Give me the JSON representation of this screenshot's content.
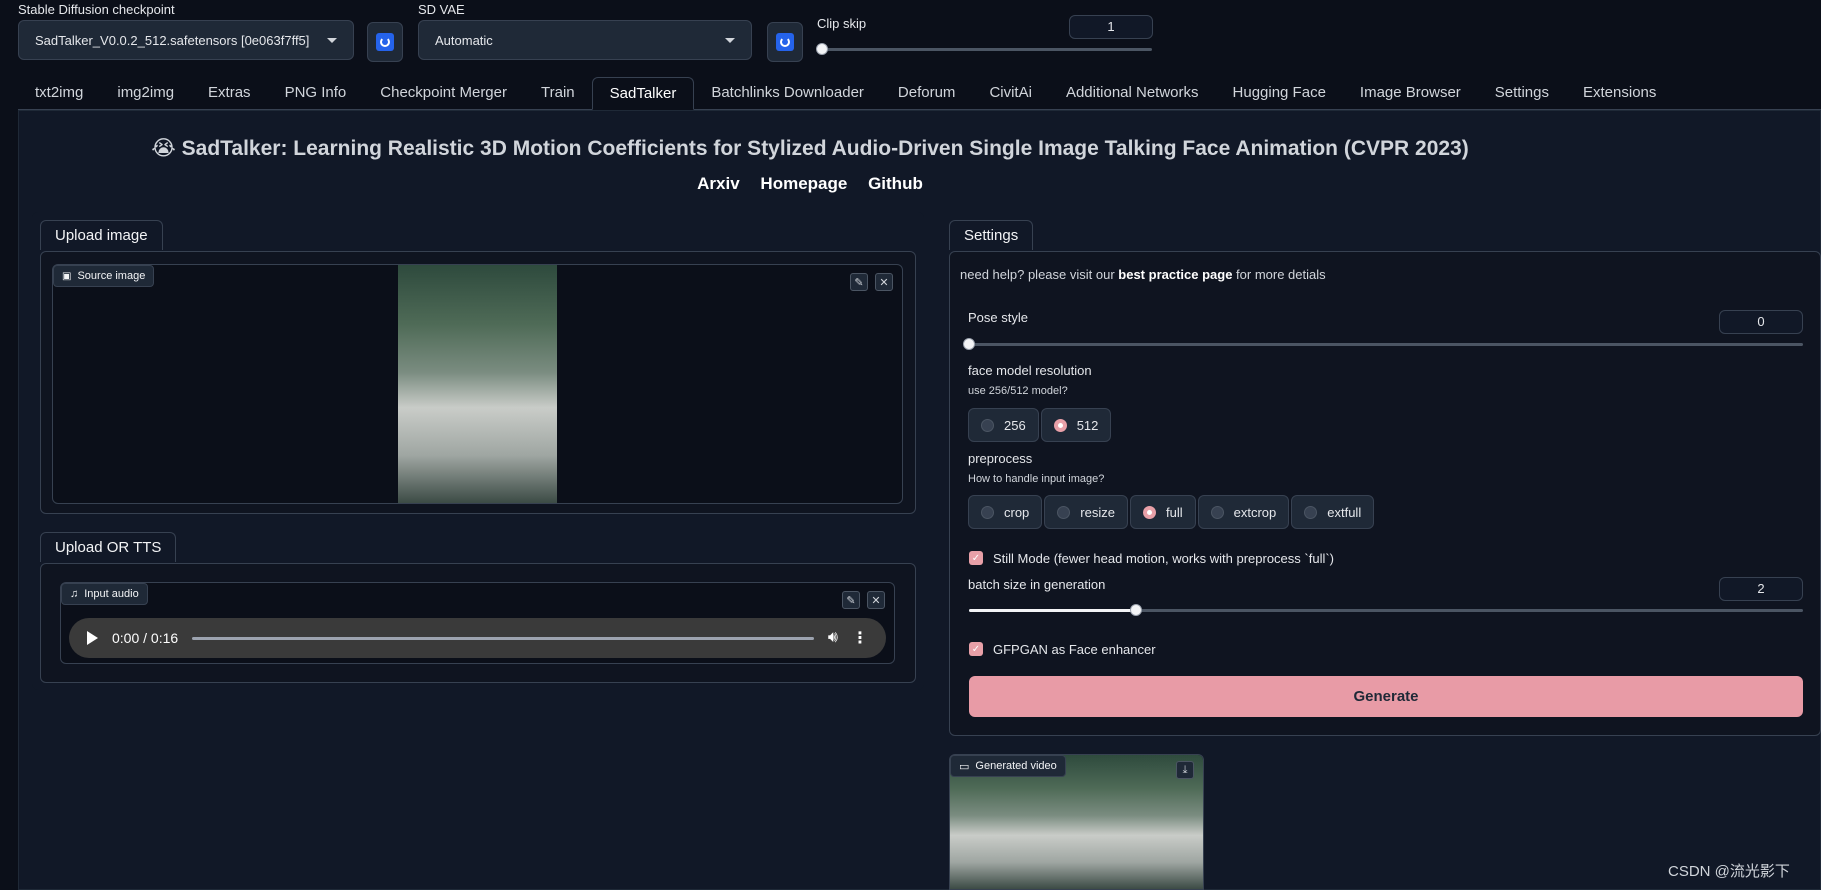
{
  "top": {
    "checkpoint_label": "Stable Diffusion checkpoint",
    "checkpoint_value": "SadTalker_V0.0.2_512.safetensors [0e063f7ff5]",
    "vae_label": "SD VAE",
    "vae_value": "Automatic",
    "clip_skip_label": "Clip skip",
    "clip_skip_value": "1",
    "clip_skip_level": 0
  },
  "tabs": [
    "txt2img",
    "img2img",
    "Extras",
    "PNG Info",
    "Checkpoint Merger",
    "Train",
    "SadTalker",
    "Batchlinks Downloader",
    "Deforum",
    "CivitAi",
    "Additional Networks",
    "Hugging Face",
    "Image Browser",
    "Settings",
    "Extensions"
  ],
  "active_tab": "SadTalker",
  "header": {
    "emoji": "😭",
    "title": "SadTalker: Learning Realistic 3D Motion Coefficients for Stylized Audio-Driven Single Image Talking Face Animation (CVPR 2023)",
    "links": [
      "Arxiv",
      "Homepage",
      "Github"
    ]
  },
  "left": {
    "upload_tab": "Upload image",
    "source_label": "Source image",
    "tts_tab": "Upload OR TTS",
    "audio_label": "Input audio",
    "audio_time": "0:00 / 0:16"
  },
  "right": {
    "settings_tab": "Settings",
    "help_prefix": "need help? please visit our ",
    "help_link": "best practice page",
    "help_suffix": " for more detials",
    "pose_label": "Pose style",
    "pose_value": "0",
    "pose_level": 0,
    "face_label": "face model resolution",
    "face_sub": "use 256/512 model?",
    "face_options": [
      "256",
      "512"
    ],
    "face_selected": "512",
    "pre_label": "preprocess",
    "pre_sub": "How to handle input image?",
    "pre_options": [
      "crop",
      "resize",
      "full",
      "extcrop",
      "extfull"
    ],
    "pre_selected": "full",
    "still_label": "Still Mode (fewer head motion, works with preprocess `full`)",
    "batch_label": "batch size in generation",
    "batch_value": "2",
    "batch_level": 0.2,
    "gfpgan_label": "GFPGAN as Face enhancer",
    "generate_label": "Generate",
    "video_label": "Generated video"
  },
  "watermark": "CSDN @流光影下",
  "colors": {
    "accent": "#e89ba6",
    "bg": "#0b0f19",
    "blue": "#2563eb"
  }
}
